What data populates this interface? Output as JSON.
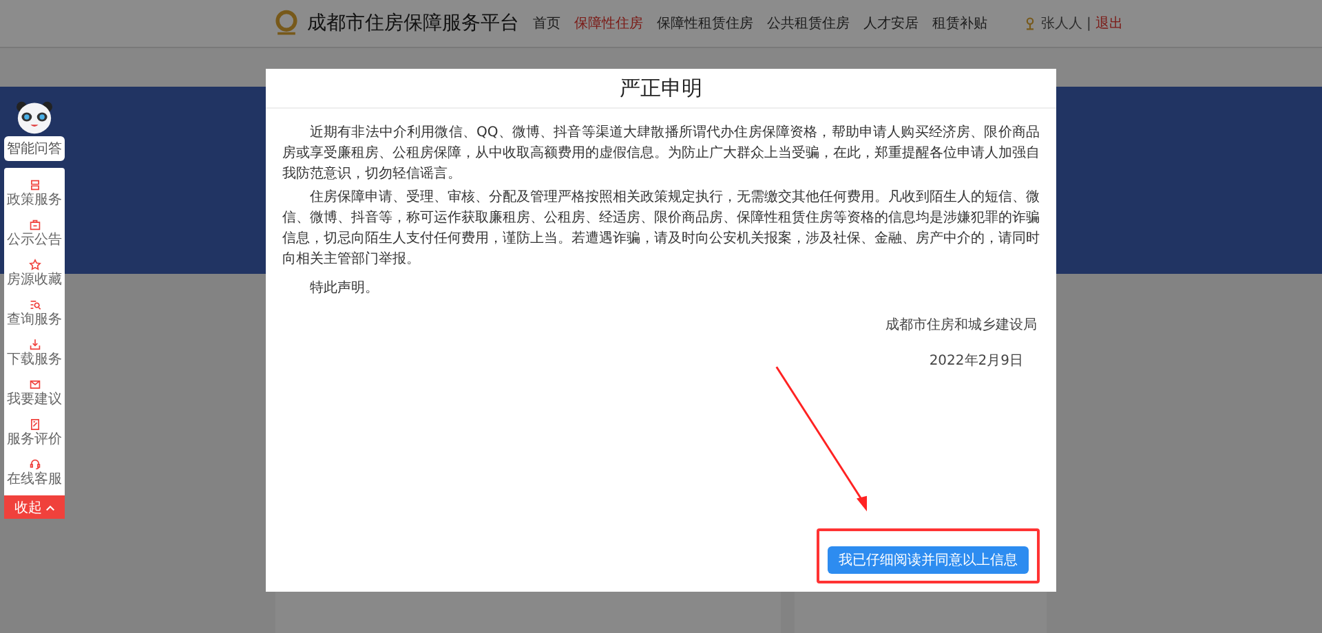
{
  "header": {
    "site_title": "成都市住房保障服务平台",
    "nav": [
      {
        "label": "首页",
        "selected": false
      },
      {
        "label": "保障性住房",
        "selected": true
      },
      {
        "label": "保障性租赁住房",
        "selected": false
      },
      {
        "label": "公共租赁住房",
        "selected": false
      },
      {
        "label": "人才安居",
        "selected": false
      },
      {
        "label": "租赁补贴",
        "selected": false
      }
    ],
    "user": {
      "name": "张人人",
      "separator": "|",
      "logout": "退出"
    }
  },
  "sidebar": {
    "assistant": "智能问答",
    "items": [
      {
        "label": "政策服务"
      },
      {
        "label": "公示公告"
      },
      {
        "label": "房源收藏"
      },
      {
        "label": "查询服务"
      },
      {
        "label": "下载服务"
      },
      {
        "label": "我要建议"
      },
      {
        "label": "服务评价"
      },
      {
        "label": "在线客服"
      }
    ],
    "collapse": "收起"
  },
  "modal": {
    "title": "严正申明",
    "paragraphs": [
      "近期有非法中介利用微信、QQ、微博、抖音等渠道大肆散播所谓代办住房保障资格，帮助申请人购买经济房、限价商品房或享受廉租房、公租房保障，从中收取高额费用的虚假信息。为防止广大群众上当受骗，在此，郑重提醒各位申请人加强自我防范意识，切勿轻信谣言。",
      "住房保障申请、受理、审核、分配及管理严格按照相关政策规定执行，无需缴交其他任何费用。凡收到陌生人的短信、微信、微博、抖音等，称可运作获取廉租房、公租房、经适房、限价商品房、保障性租赁住房等资格的信息均是涉嫌犯罪的诈骗信息，切忌向陌生人支付任何费用，谨防上当。若遭遇诈骗，请及时向公安机关报案，涉及社保、金融、房产中介的，请同时向相关主管部门举报。",
      "特此声明。"
    ],
    "signature": "成都市住房和城乡建设局",
    "date": "2022年2月9日",
    "confirm_button": "我已仔细阅读并同意以上信息"
  }
}
